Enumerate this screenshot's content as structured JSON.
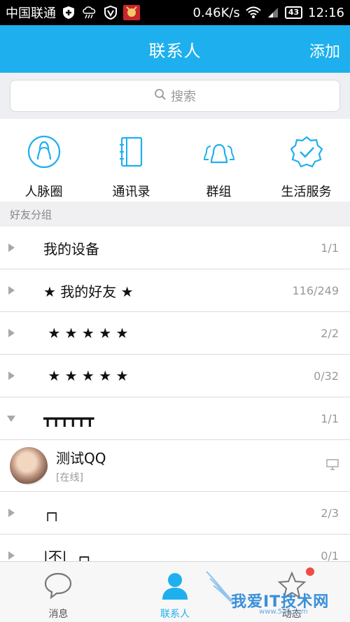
{
  "status_bar": {
    "carrier": "中国联通",
    "speed": "0.46K/s",
    "battery": "43",
    "time": "12:16",
    "icons": [
      "shield-plus-icon",
      "weather-icon",
      "vpn-icon",
      "app-icon",
      "wifi-icon",
      "signal-icon",
      "battery-icon"
    ]
  },
  "nav": {
    "title": "联系人",
    "add_label": "添加"
  },
  "search": {
    "placeholder": "搜索"
  },
  "quick_actions": [
    {
      "label": "人脉圈",
      "icon": "person-circle-icon"
    },
    {
      "label": "通讯录",
      "icon": "address-book-icon"
    },
    {
      "label": "群组",
      "icon": "group-icon"
    },
    {
      "label": "生活服务",
      "icon": "service-badge-icon"
    }
  ],
  "section": {
    "title": "好友分组"
  },
  "groups": [
    {
      "name": "我的设备",
      "count": "1/1",
      "expanded": false
    },
    {
      "name": "★ 我的好友 ★",
      "count": "116/249",
      "expanded": false
    },
    {
      "name": " ★ ★ ★ ★ ★",
      "count": "2/2",
      "expanded": false
    },
    {
      "name": " ★ ★ ★ ★ ★",
      "count": "0/32",
      "expanded": false
    },
    {
      "name": "┳┳┳┳┳┳",
      "count": "1/1",
      "expanded": true
    }
  ],
  "contact": {
    "name": "测试QQ",
    "status": "[在线]",
    "device_icon": "monitor-icon"
  },
  "groups_after": [
    {
      "name": "┌┐",
      "count": "2/3"
    },
    {
      "name": "|不|  ┌┐",
      "count": "0/1"
    }
  ],
  "tabs": [
    {
      "label": "消息",
      "icon": "chat-bubble-icon",
      "active": false
    },
    {
      "label": "联系人",
      "icon": "contact-person-icon",
      "active": true
    },
    {
      "label": "动态",
      "icon": "star-icon",
      "active": false
    }
  ],
  "watermark": {
    "text": "我爱IT技术网",
    "sub": "www.52ij.com"
  },
  "colors": {
    "accent": "#1eb0ee",
    "badge": "#f24a45"
  }
}
